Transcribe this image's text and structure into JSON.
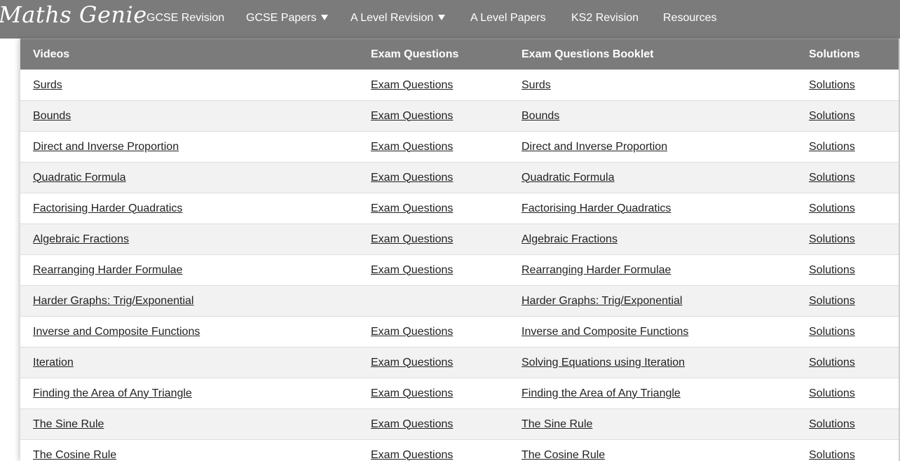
{
  "brand": {
    "logo_text": "Maths Genie"
  },
  "nav": {
    "items": [
      {
        "label": "GCSE Revision",
        "dropdown": false
      },
      {
        "label": "GCSE Papers",
        "dropdown": true
      },
      {
        "label": "A Level Revision",
        "dropdown": true
      },
      {
        "label": "A Level Papers",
        "dropdown": false
      },
      {
        "label": "KS2 Revision",
        "dropdown": false
      },
      {
        "label": "Resources",
        "dropdown": false
      }
    ]
  },
  "colors": {
    "nav_background": "#7b7b7b",
    "header_background": "#7b7b7b",
    "row_alt_background": "#f2f2f2",
    "text": "#222222"
  },
  "table": {
    "headers": [
      "Videos",
      "Exam Questions",
      "Exam Questions Booklet",
      "Solutions"
    ],
    "rows": [
      [
        "Surds",
        "Exam Questions",
        "Surds",
        "Solutions"
      ],
      [
        "Bounds",
        "Exam Questions",
        "Bounds",
        "Solutions"
      ],
      [
        "Direct and Inverse Proportion",
        "Exam Questions",
        "Direct and Inverse Proportion",
        "Solutions"
      ],
      [
        "Quadratic Formula",
        "Exam Questions",
        "Quadratic Formula",
        "Solutions"
      ],
      [
        "Factorising Harder Quadratics",
        "Exam Questions",
        "Factorising Harder Quadratics",
        "Solutions"
      ],
      [
        "Algebraic Fractions",
        "Exam Questions",
        "Algebraic Fractions",
        "Solutions"
      ],
      [
        "Rearranging Harder Formulae",
        "Exam Questions",
        "Rearranging Harder Formulae",
        "Solutions"
      ],
      [
        "Harder Graphs: Trig/Exponential",
        "",
        "Harder Graphs: Trig/Exponential",
        "Solutions"
      ],
      [
        "Inverse and Composite Functions",
        "Exam Questions",
        "Inverse and Composite Functions",
        "Solutions"
      ],
      [
        "Iteration",
        "Exam Questions",
        "Solving Equations using Iteration",
        "Solutions"
      ],
      [
        "Finding the Area of Any Triangle",
        "Exam Questions",
        "Finding the Area of Any Triangle",
        "Solutions"
      ],
      [
        "The Sine Rule",
        "Exam Questions",
        "The Sine Rule",
        "Solutions"
      ],
      [
        "The Cosine Rule",
        "Exam Questions",
        "The Cosine Rule",
        "Solutions"
      ]
    ]
  }
}
